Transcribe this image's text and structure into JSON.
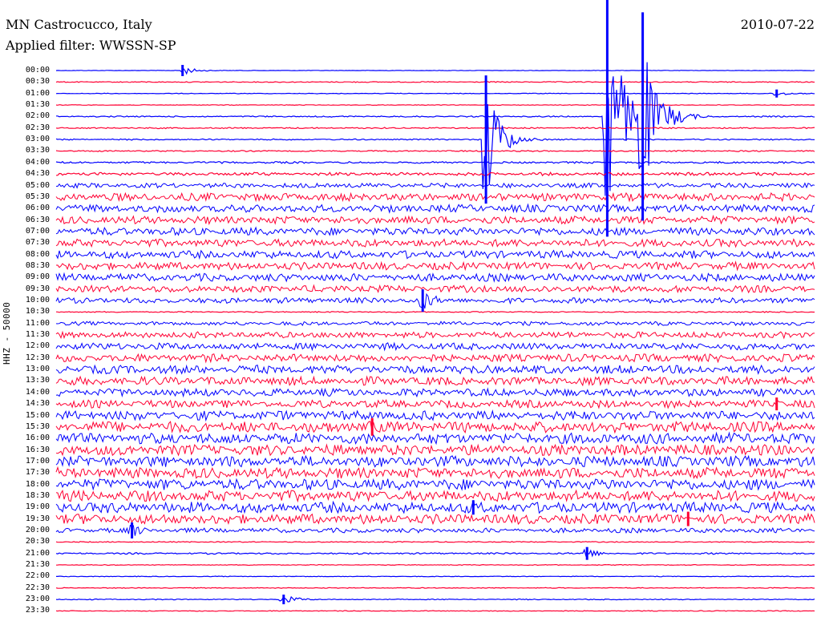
{
  "header": {
    "station": "MN Castrocucco, Italy",
    "filter": "Applied filter: WWSSN-SP",
    "date": "2010-07-22"
  },
  "chart_data": {
    "type": "line",
    "title": "MN Castrocucco, Italy",
    "subtitle": "Applied filter: WWSSN-SP",
    "ylabel": "HHZ - 50000",
    "colors": {
      "even_trace": "#0000ff",
      "odd_trace": "#ff0033",
      "background": "#ffffff"
    },
    "row_labels": [
      "00:00",
      "00:30",
      "01:00",
      "01:30",
      "02:00",
      "02:30",
      "03:00",
      "03:30",
      "04:00",
      "04:30",
      "05:00",
      "05:30",
      "06:00",
      "06:30",
      "07:00",
      "07:30",
      "08:00",
      "08:30",
      "09:00",
      "09:30",
      "10:00",
      "10:30",
      "11:00",
      "11:30",
      "12:00",
      "12:30",
      "13:00",
      "13:30",
      "14:00",
      "14:30",
      "15:00",
      "15:30",
      "16:00",
      "16:30",
      "17:00",
      "17:30",
      "18:00",
      "18:30",
      "19:00",
      "19:30",
      "20:00",
      "20:30",
      "21:00",
      "21:30",
      "22:00",
      "22:30",
      "23:00",
      "23:30"
    ],
    "noise_level": [
      0.3,
      0.6,
      0.4,
      0.4,
      0.8,
      0.8,
      0.8,
      0.8,
      1.2,
      2,
      3,
      5,
      5,
      5,
      5,
      5,
      5,
      5,
      5,
      4.5,
      3.5,
      0.7,
      2.5,
      4,
      4.5,
      5,
      5.5,
      5.5,
      5,
      5,
      6,
      7,
      7,
      7,
      7,
      7,
      7,
      7,
      7,
      6.5,
      3,
      0.6,
      1,
      0.5,
      0.4,
      0.5,
      0.6,
      0.5
    ],
    "events": [
      {
        "row": 0,
        "minute": 5.0,
        "amplitude": 7
      },
      {
        "row": 2,
        "minute": 28.5,
        "amplitude": 5
      },
      {
        "row": 6,
        "minute": 17.0,
        "amplitude": 80
      },
      {
        "row": 4,
        "minute": 21.8,
        "amplitude": 150
      },
      {
        "row": 4,
        "minute": 23.2,
        "amplitude": 130
      },
      {
        "row": 20,
        "minute": 14.5,
        "amplitude": 14
      },
      {
        "row": 29,
        "minute": 28.5,
        "amplitude": 8
      },
      {
        "row": 31,
        "minute": 12.5,
        "amplitude": 11
      },
      {
        "row": 38,
        "minute": 16.5,
        "amplitude": 9
      },
      {
        "row": 39,
        "minute": 25.0,
        "amplitude": 9
      },
      {
        "row": 40,
        "minute": 3.0,
        "amplitude": 10
      },
      {
        "row": 42,
        "minute": 21.0,
        "amplitude": 8
      },
      {
        "row": 46,
        "minute": 9.0,
        "amplitude": 6
      }
    ]
  }
}
